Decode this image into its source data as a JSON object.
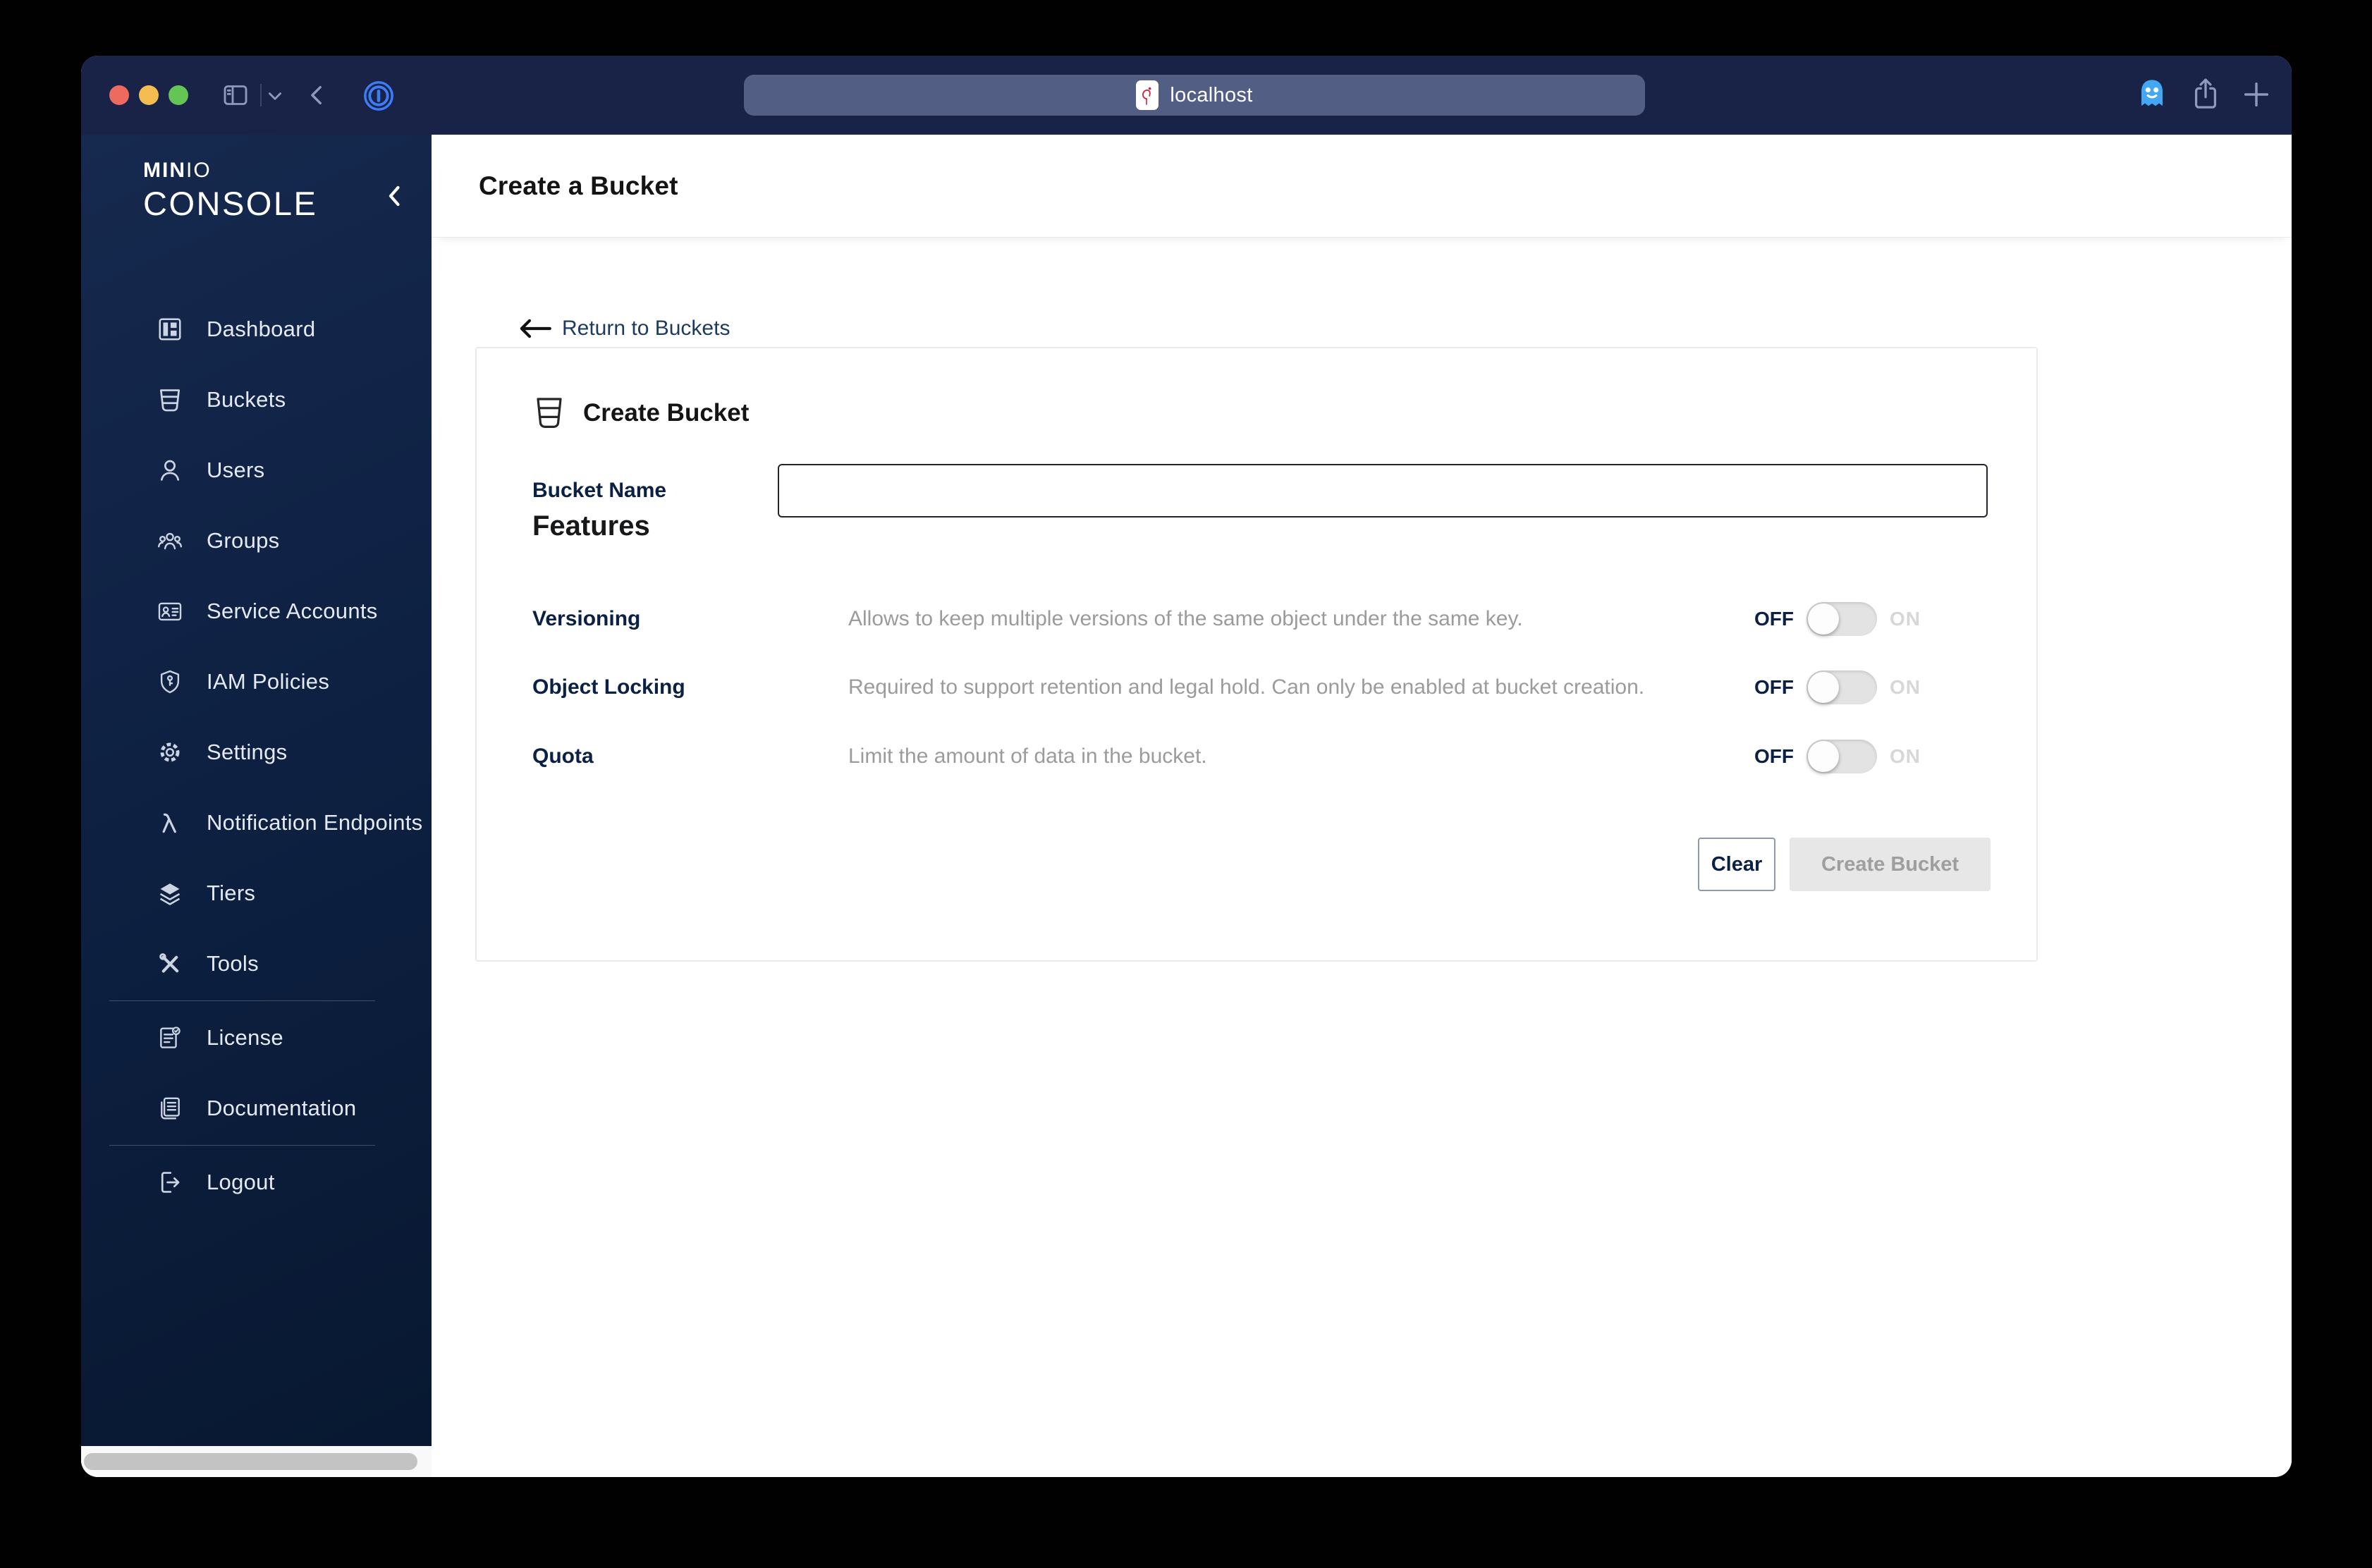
{
  "browser": {
    "address": "localhost",
    "favicon": "minio-flamingo-icon",
    "left_icons": [
      "sidebar-toggle-icon",
      "chevron-down-icon",
      "back-icon",
      "onepassword-icon"
    ],
    "right_icons": [
      "ghostery-icon",
      "share-icon",
      "new-tab-icon"
    ]
  },
  "sidebar": {
    "logo": {
      "brand_bold": "MIN",
      "brand_light": "IO",
      "product": "CONSOLE"
    },
    "collapse_icon": "chevron-left-icon",
    "items": [
      {
        "icon": "dashboard-icon",
        "label": "Dashboard"
      },
      {
        "icon": "bucket-icon",
        "label": "Buckets"
      },
      {
        "icon": "user-icon",
        "label": "Users"
      },
      {
        "icon": "groups-icon",
        "label": "Groups"
      },
      {
        "icon": "service-accounts-icon",
        "label": "Service Accounts"
      },
      {
        "icon": "shield-key-icon",
        "label": "IAM Policies"
      },
      {
        "icon": "gear-icon",
        "label": "Settings"
      },
      {
        "icon": "lambda-icon",
        "label": "Notification Endpoints"
      },
      {
        "icon": "layers-icon",
        "label": "Tiers"
      },
      {
        "icon": "tools-icon",
        "label": "Tools"
      },
      {
        "icon": "license-icon",
        "label": "License"
      },
      {
        "icon": "documentation-icon",
        "label": "Documentation"
      },
      {
        "icon": "logout-icon",
        "label": "Logout"
      }
    ]
  },
  "page": {
    "title": "Create a Bucket",
    "back_link_label": "Return to Buckets"
  },
  "form": {
    "title": "Create Bucket",
    "title_icon": "bucket-icon",
    "bucket_name": {
      "label": "Bucket Name",
      "value": ""
    },
    "features_heading": "Features",
    "features": [
      {
        "label": "Versioning",
        "description": "Allows to keep multiple versions of the same object under the same key.",
        "state": "off",
        "off_label": "OFF",
        "on_label": "ON"
      },
      {
        "label": "Object Locking",
        "description": "Required to support retention and legal hold. Can only be enabled at bucket creation.",
        "state": "off",
        "off_label": "OFF",
        "on_label": "ON"
      },
      {
        "label": "Quota",
        "description": "Limit the amount of data in the bucket.",
        "state": "off",
        "off_label": "OFF",
        "on_label": "ON"
      }
    ],
    "buttons": {
      "clear": "Clear",
      "create": "Create Bucket",
      "create_enabled": false
    }
  },
  "colors": {
    "titlebar": "#192348",
    "address_bar": "#535e84",
    "sidebar_gradient_top": "#16294e",
    "sidebar_gradient_bottom": "#081831",
    "brand_flamingo_red": "#c7233f",
    "label_navy": "#0a2045",
    "link_navy": "#1d3a5f",
    "muted_text": "#9b9b9b",
    "toggle_track": "#e3e3e3",
    "disabled_button_bg": "#e7e7e7",
    "disabled_button_text": "#9e9e9e",
    "traffic_close": "#ee6a5f",
    "traffic_minimize": "#f5bd4f",
    "traffic_zoom": "#62c554"
  }
}
